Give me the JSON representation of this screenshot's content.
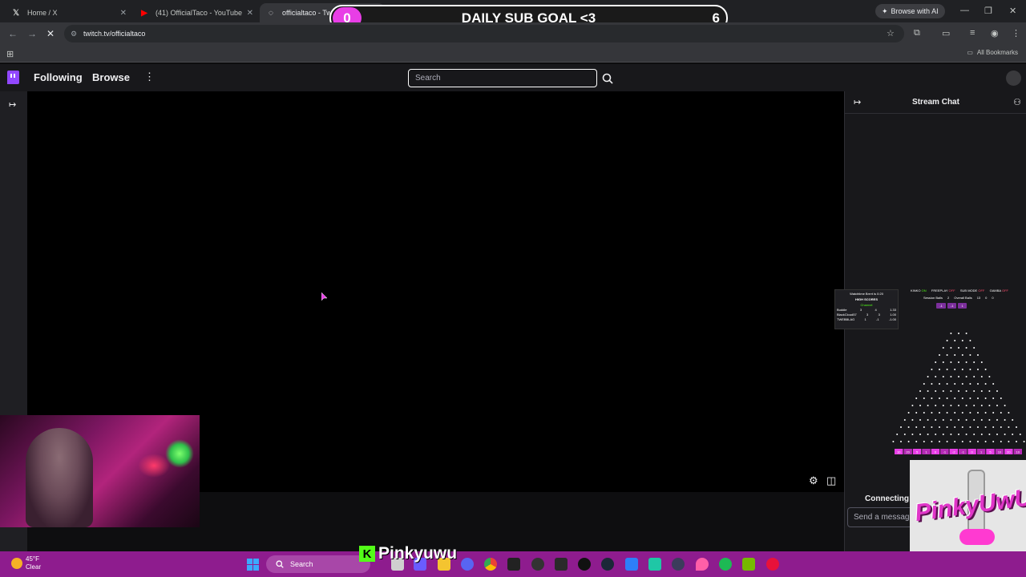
{
  "browser": {
    "tabs": [
      {
        "title": "Home / X",
        "icon": "x-logo-icon"
      },
      {
        "title": "(41) OfficialTaco - YouTube",
        "icon": "youtube-icon"
      },
      {
        "title": "officialtaco - Twitch",
        "icon": "loading-icon"
      }
    ],
    "browse_ai_label": "Browse with AI",
    "url": "twitch.tv/officialtaco",
    "bookmarks_label": "All Bookmarks"
  },
  "sub_goal": {
    "current": "0",
    "label": "DAILY SUB GOAL <3",
    "target": "6",
    "accent": "#e83ee6"
  },
  "twitch": {
    "nav": {
      "following": "Following",
      "browse": "Browse",
      "search_placeholder": "Search"
    },
    "chat": {
      "title": "Stream Chat",
      "status": "Connecting",
      "input_placeholder": "Send a message"
    },
    "brand_color": "#9147ff"
  },
  "plinko": {
    "watchtime_label": "Watchtime Brrrrt is 0:20",
    "high_scores_title": "HIGH SCORES",
    "channel_label": "Channel",
    "scores": [
      {
        "name": "Buddie",
        "a": "3",
        "b": "4",
        "c": "1.33"
      },
      {
        "name": "BlackCloud57",
        "a": "3",
        "b": "3",
        "c": "1.00"
      },
      {
        "name": "TWEBBLAG",
        "a": "1",
        "b": "-1",
        "c": "-1.00"
      }
    ],
    "modes": [
      {
        "name": "KINKO",
        "state": "ON"
      },
      {
        "name": "FREEPLAY",
        "state": "OFF"
      },
      {
        "name": "SUB MODE",
        "state": "OFF"
      },
      {
        "name": "GAMBA",
        "state": "OFF"
      }
    ],
    "session_balls_label": "Session Balls",
    "session_balls": "2",
    "overall_balls_label": "Overall Balls",
    "overall_balls": "13",
    "extra_values": [
      "0",
      "0"
    ],
    "buttons": [
      "-1",
      "-1",
      "1"
    ],
    "slot_values": [
      "10",
      "20",
      "5",
      "1",
      "0",
      "-1",
      "-2",
      "-1",
      "0",
      "1",
      "5",
      "10",
      "20",
      "10"
    ]
  },
  "streamer": {
    "kick_letter": "K",
    "name": "Pinkyuwu",
    "logo_text": "PinkyUwU"
  },
  "taskbar": {
    "temp": "45°F",
    "condition": "Clear",
    "search_label": "Search",
    "color": "#8e1c8e"
  }
}
